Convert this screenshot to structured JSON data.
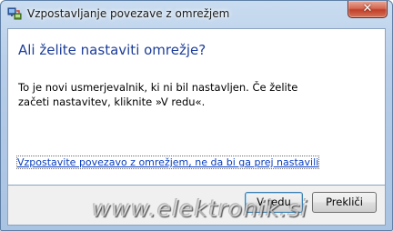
{
  "window": {
    "title": "Vzpostavljanje povezave z omrežjem",
    "close_glyph": "✕"
  },
  "content": {
    "heading": "Ali želite nastaviti omrežje?",
    "description": "To je novi usmerjevalnik, ki ni bil nastavljen. Če želite začeti nastavitev, kliknite »V redu«.",
    "link": "Vzpostavite povezavo z omrežjem, ne da bi ga prej nastavili"
  },
  "buttons": {
    "ok": "V redu",
    "cancel": "Prekliči"
  },
  "watermark": "www.elektronik.si",
  "icons": {
    "app": "network-setup-icon",
    "close": "close-icon"
  },
  "colors": {
    "heading": "#1e3f99",
    "link": "#0b3fbd",
    "close_button": "#c0402a"
  }
}
